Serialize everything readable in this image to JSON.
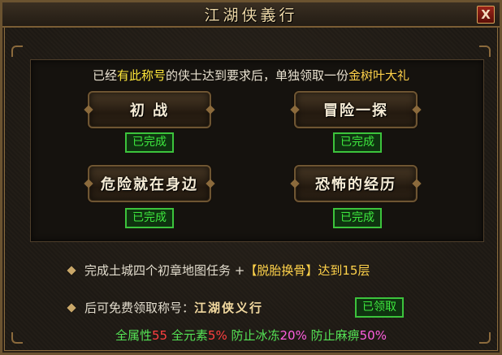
{
  "window": {
    "title": "江湖侠義行",
    "close_label": "X"
  },
  "intro": {
    "part1": "已经",
    "highlight1": "有此称号",
    "part2": "的侠士达到要求后，单独领取一份",
    "highlight2": "金树叶大礼"
  },
  "achievements": [
    {
      "name": "初  战",
      "status": "已完成"
    },
    {
      "name": "冒险一探",
      "status": "已完成"
    },
    {
      "name": "危险就在身边",
      "status": "已完成"
    },
    {
      "name": "恐怖的经历",
      "status": "已完成"
    }
  ],
  "task": {
    "prefix": "完成土城四个初章地图任务 + ",
    "highlight": "【脱胎换骨】",
    "suffix": "达到15层"
  },
  "reward": {
    "prefix": "后可免费领取称号：",
    "title_name": "江湖侠义行",
    "button_label": "已领取"
  },
  "stats": [
    {
      "label": "全属性",
      "value": "55"
    },
    {
      "label": "全元素",
      "value": "5%"
    },
    {
      "label": "防止冰冻",
      "value": "20%"
    },
    {
      "label": "防止麻痹",
      "value": "50%"
    }
  ],
  "colors": {
    "highlight_yellow": "#ffe83a",
    "highlight_gold": "#ffd24a",
    "done_green": "#3ee83e",
    "stat_red": "#ff4040",
    "stat_pink": "#ff5ee0"
  }
}
